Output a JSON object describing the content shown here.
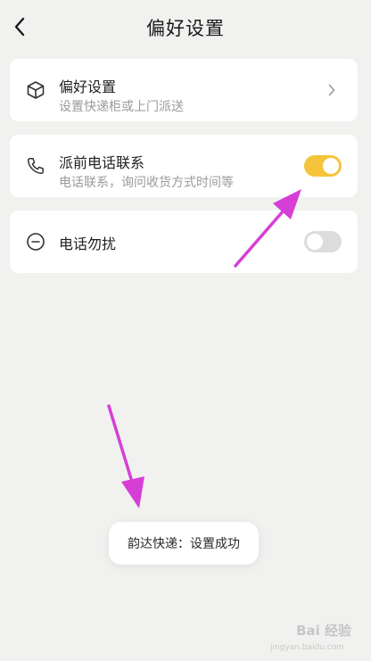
{
  "header": {
    "title": "偏好设置",
    "back_icon": "chevron-left-icon"
  },
  "settings": [
    {
      "icon": "box-icon",
      "title": "偏好设置",
      "subtitle": "设置快递柜或上门派送",
      "control": "chevron"
    },
    {
      "icon": "phone-icon",
      "title": "派前电话联系",
      "subtitle": "电话联系，询问收货方式时间等",
      "control": "toggle",
      "toggle_on": true
    },
    {
      "icon": "minus-circle-icon",
      "title": "电话勿扰",
      "control": "toggle",
      "toggle_on": false
    }
  ],
  "toast": {
    "text": "韵达快递：设置成功"
  },
  "watermark": {
    "text": "Bai 经验",
    "sub": "jingyan.baidu.com"
  },
  "colors": {
    "background": "#f1f2f0",
    "toggle_on": "#f5c43a",
    "toggle_off": "#dcdcdc",
    "annotation_arrow": "#d63fd6"
  }
}
